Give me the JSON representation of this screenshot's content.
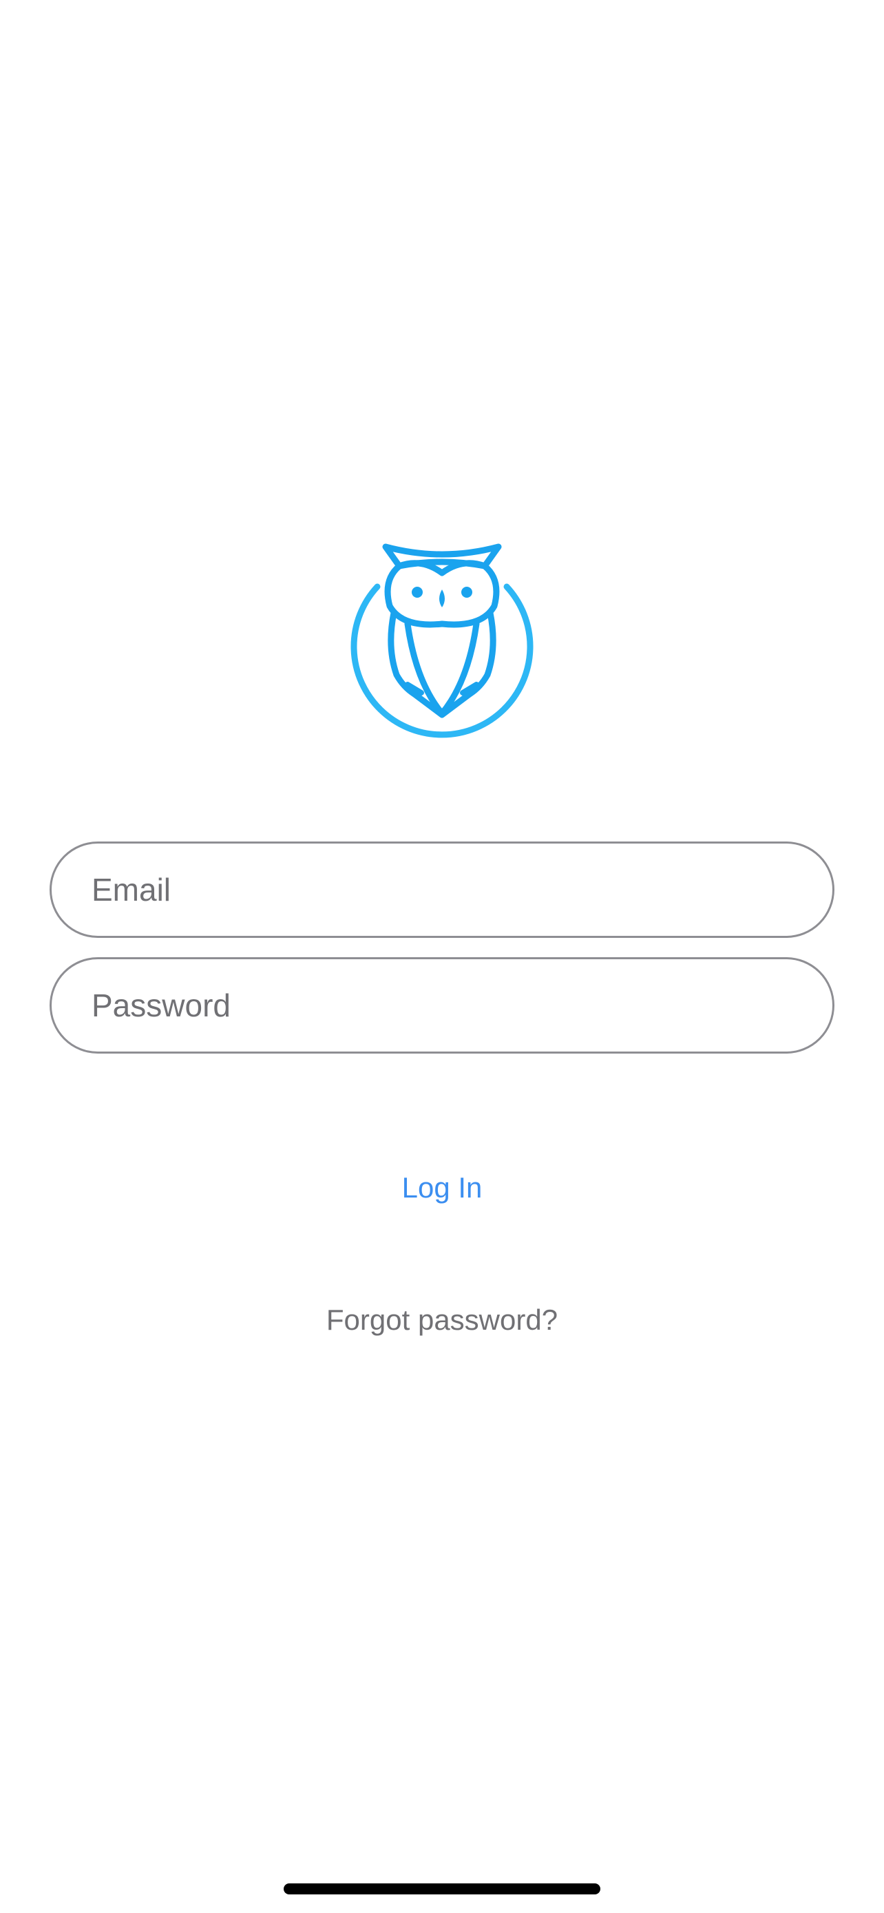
{
  "logo": {
    "icon": "owl-logo-icon",
    "color": "#1aa3ee",
    "ring_color": "#2db7f5"
  },
  "login_form": {
    "email": {
      "value": "",
      "placeholder": "Email"
    },
    "password": {
      "value": "",
      "placeholder": "Password"
    },
    "login_label": "Log In",
    "forgot_label": "Forgot password?"
  },
  "colors": {
    "accent": "#3b8ef0",
    "field_border": "#8e8e93",
    "secondary_text": "#707074",
    "background": "#ffffff"
  }
}
